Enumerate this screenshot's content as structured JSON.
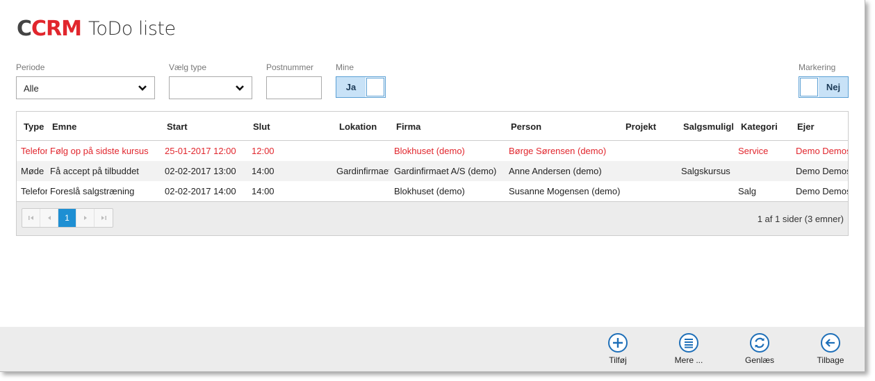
{
  "header": {
    "logo_part1": "C",
    "logo_part2": "CRM",
    "title": "ToDo liste"
  },
  "filters": {
    "periode": {
      "label": "Periode",
      "value": "Alle"
    },
    "type": {
      "label": "Vælg type",
      "value": ""
    },
    "postnummer": {
      "label": "Postnummer",
      "value": ""
    },
    "mine": {
      "label": "Mine",
      "value": "Ja"
    },
    "markering": {
      "label": "Markering",
      "value": "Nej"
    }
  },
  "table": {
    "columns": [
      "Type",
      "Emne",
      "Start",
      "Slut",
      "Lokation",
      "Firma",
      "Person",
      "Projekt",
      "Salgsmulighed",
      "Kategori",
      "Ejer"
    ],
    "rows": [
      [
        "Telefon",
        "Følg op på sidste kursus",
        "25-01-2017 12:00",
        "12:00",
        "",
        "Blokhuset (demo)",
        "Børge Sørensen (demo)",
        "",
        "",
        "Service",
        "Demo Demosen"
      ],
      [
        "Møde",
        "Få accept på tilbuddet",
        "02-02-2017 13:00",
        "14:00",
        "Gardinfirmaet",
        "Gardinfirmaet A/S (demo)",
        "Anne Andersen (demo)",
        "",
        "Salgskursus",
        "",
        "Demo Demosen"
      ],
      [
        "Telefon",
        "Foreslå salgstræning",
        "02-02-2017 14:00",
        "14:00",
        "",
        "Blokhuset (demo)",
        "Susanne Mogensen (demo)",
        "",
        "",
        "Salg",
        "Demo Demosen"
      ]
    ],
    "highlight_color": "#e1262d"
  },
  "pager": {
    "current_page": "1",
    "info": "1 af 1 sider (3 emner)"
  },
  "toolbar": {
    "add": {
      "label": "Tilføj",
      "icon": "plus-circle-icon"
    },
    "more": {
      "label": "Mere ...",
      "icon": "menu-circle-icon"
    },
    "reload": {
      "label": "Genlæs",
      "icon": "refresh-circle-icon"
    },
    "back": {
      "label": "Tilbage",
      "icon": "arrow-left-circle-icon"
    }
  },
  "colors": {
    "accent": "#1e8fd3",
    "toggle_on": "#c8e2f7",
    "brand_red": "#e1262d"
  }
}
